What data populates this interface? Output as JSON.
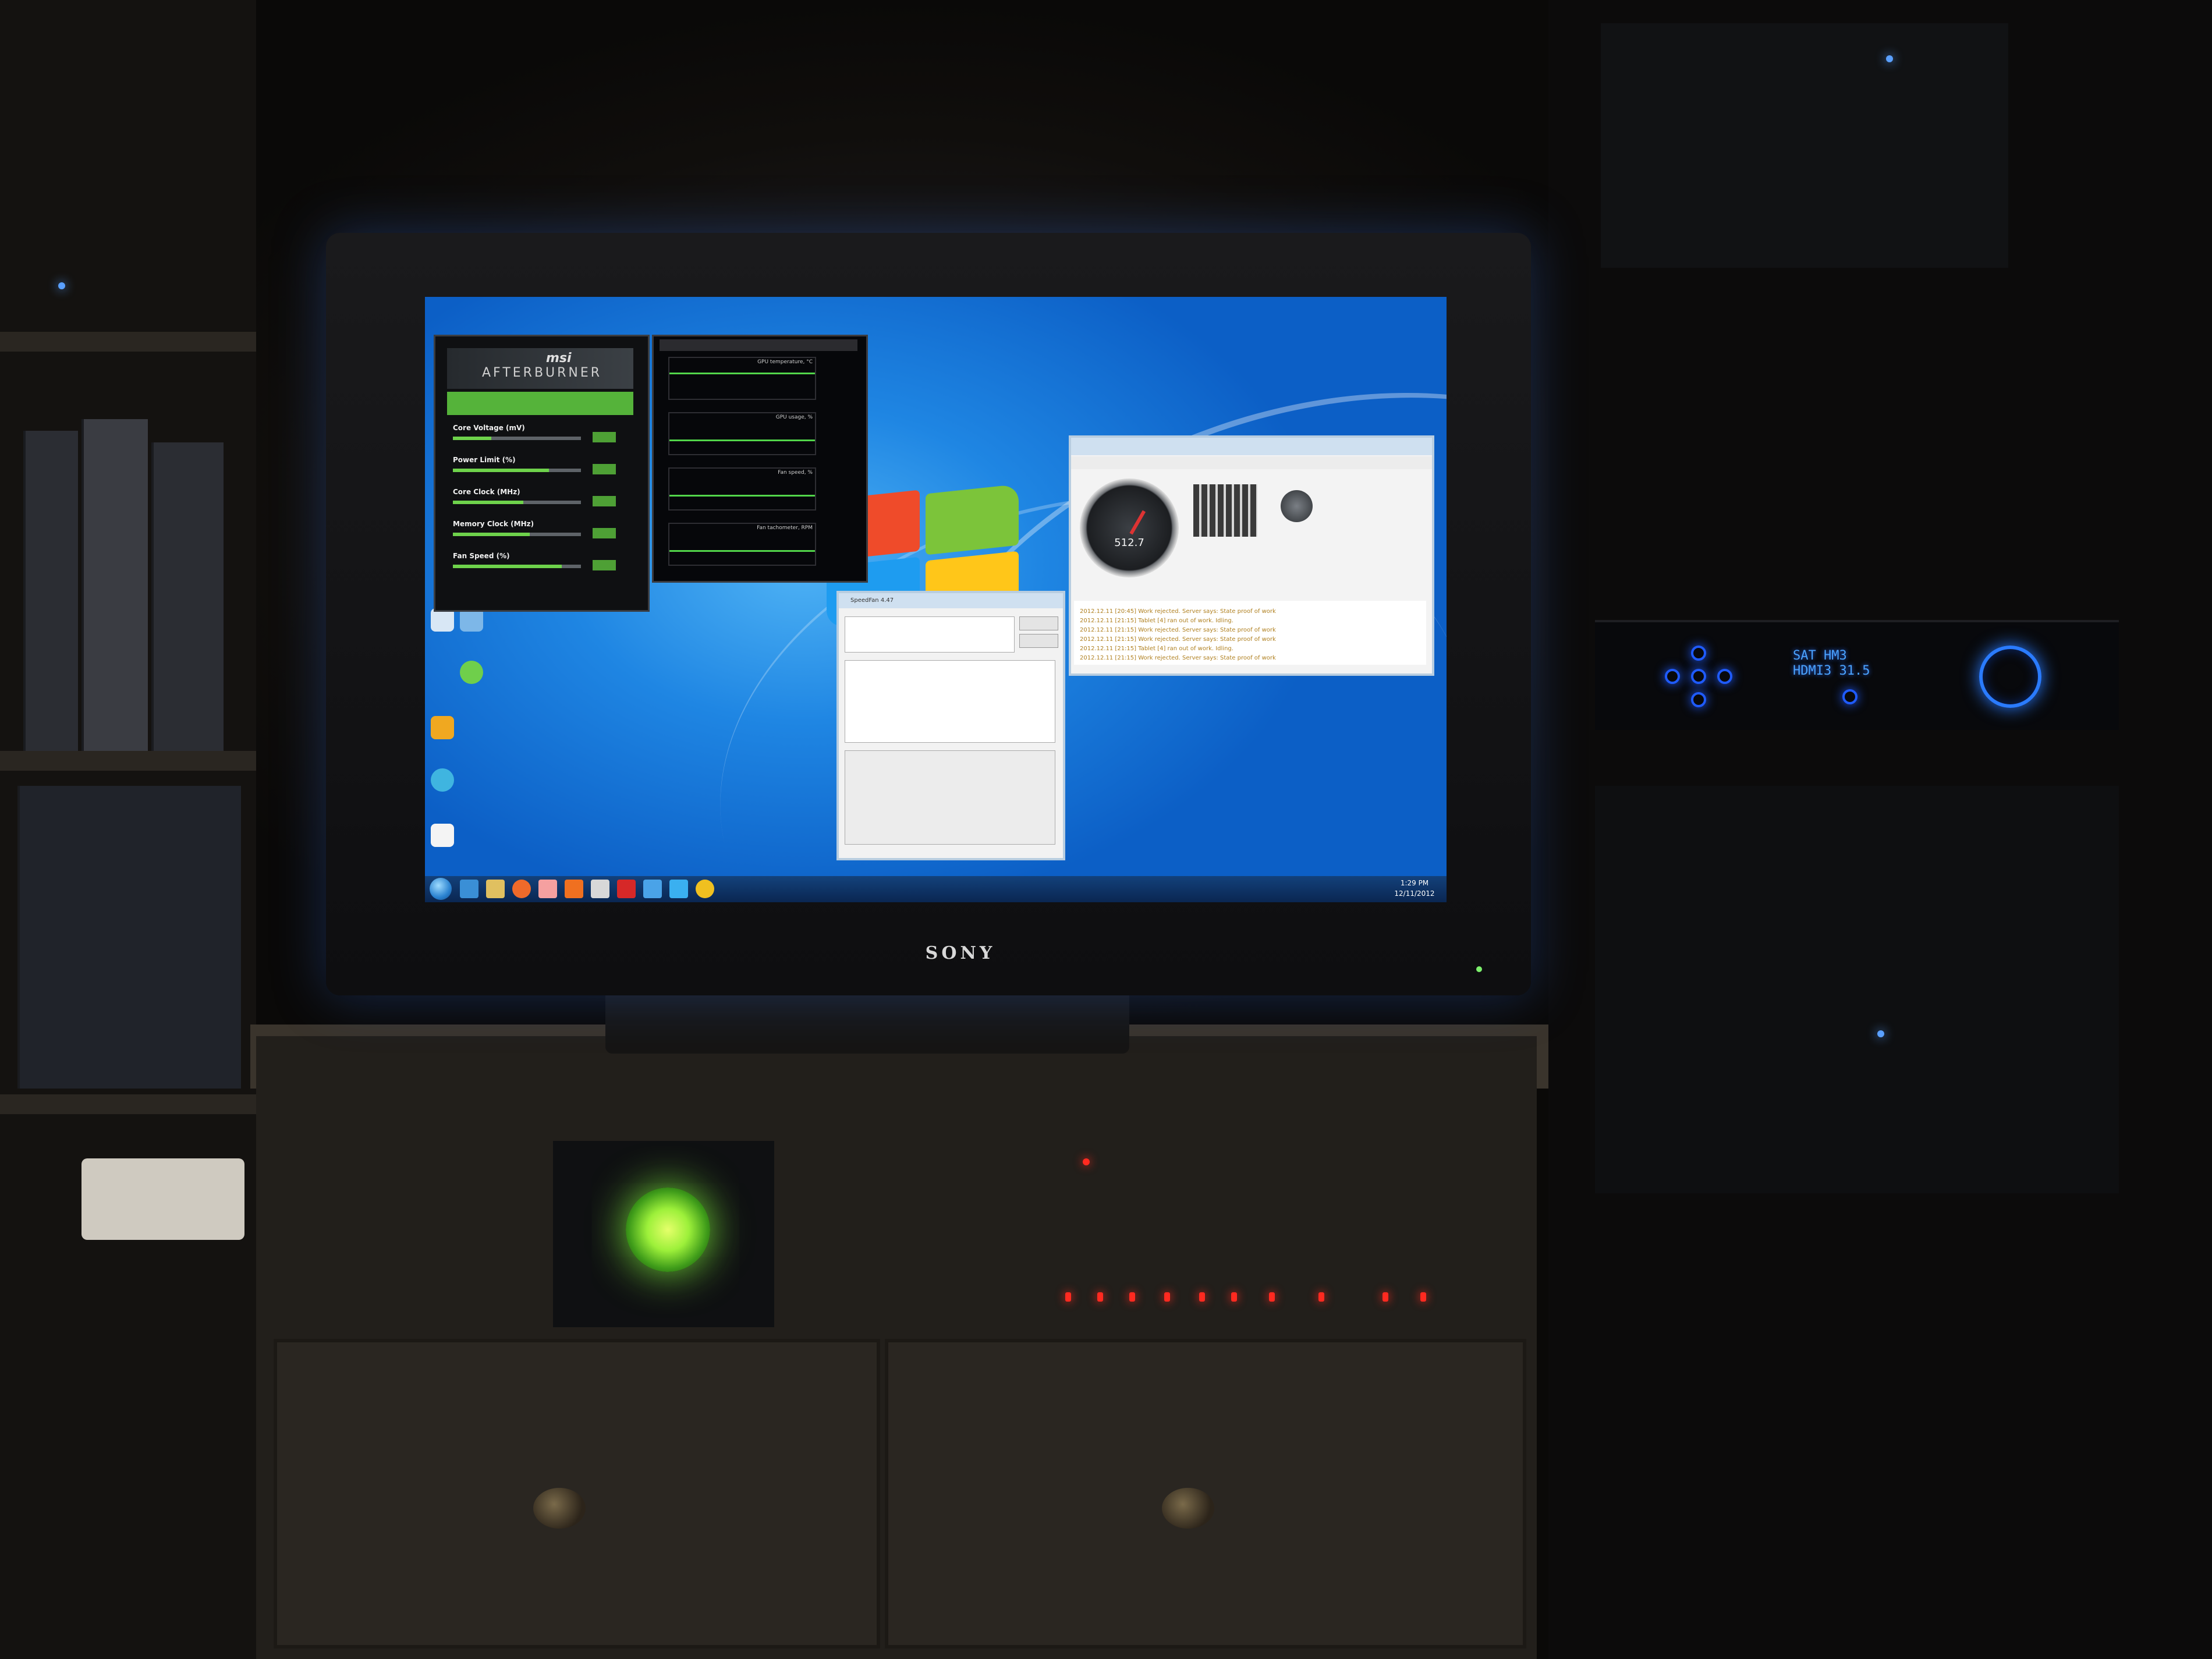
{
  "tv": {
    "brand": "SONY"
  },
  "afterburner": {
    "brand": "msi",
    "title": "AFTERBURNER",
    "sliders": [
      {
        "label": "Core Voltage (mV)",
        "level": 0.3
      },
      {
        "label": "Power Limit (%)",
        "level": 0.75
      },
      {
        "label": "Core Clock (MHz)",
        "level": 0.55
      },
      {
        "label": "Memory Clock (MHz)",
        "level": 0.6
      },
      {
        "label": "Fan Speed (%)",
        "level": 0.85
      }
    ]
  },
  "hardware_monitor": {
    "graphs": [
      {
        "label": "GPU temperature, °C"
      },
      {
        "label": "GPU usage, %"
      },
      {
        "label": "Fan speed, %"
      },
      {
        "label": "Fan tachometer, RPM"
      }
    ]
  },
  "boinc": {
    "gauge_readout": "512.7",
    "log_lines": [
      "2012.12.11 [20:45] Work rejected. Server says: State proof of work",
      "2012.12.11 [21:15] Tablet [4] ran out of work. Idling.",
      "2012.12.11 [21:15] Work rejected. Server says: State proof of work",
      "2012.12.11 [21:15] Work rejected. Server says: State proof of work",
      "2012.12.11 [21:15] Tablet [4] ran out of work. Idling.",
      "2012.12.11 [21:15] Work rejected. Server says: State proof of work"
    ]
  },
  "speedfan": {
    "title": "SpeedFan 4.47"
  },
  "taskbar": {
    "clock_time": "1:29 PM",
    "clock_date": "12/11/2012"
  },
  "receiver": {
    "display_line1": "SAT  HM3",
    "display_line2": "HDMI3 31.5"
  },
  "colors": {
    "desktop_blue": "#1f86e3",
    "fan_green": "#9df03a",
    "receiver_blue": "#1f5bff",
    "led_red": "#ff2a20"
  }
}
